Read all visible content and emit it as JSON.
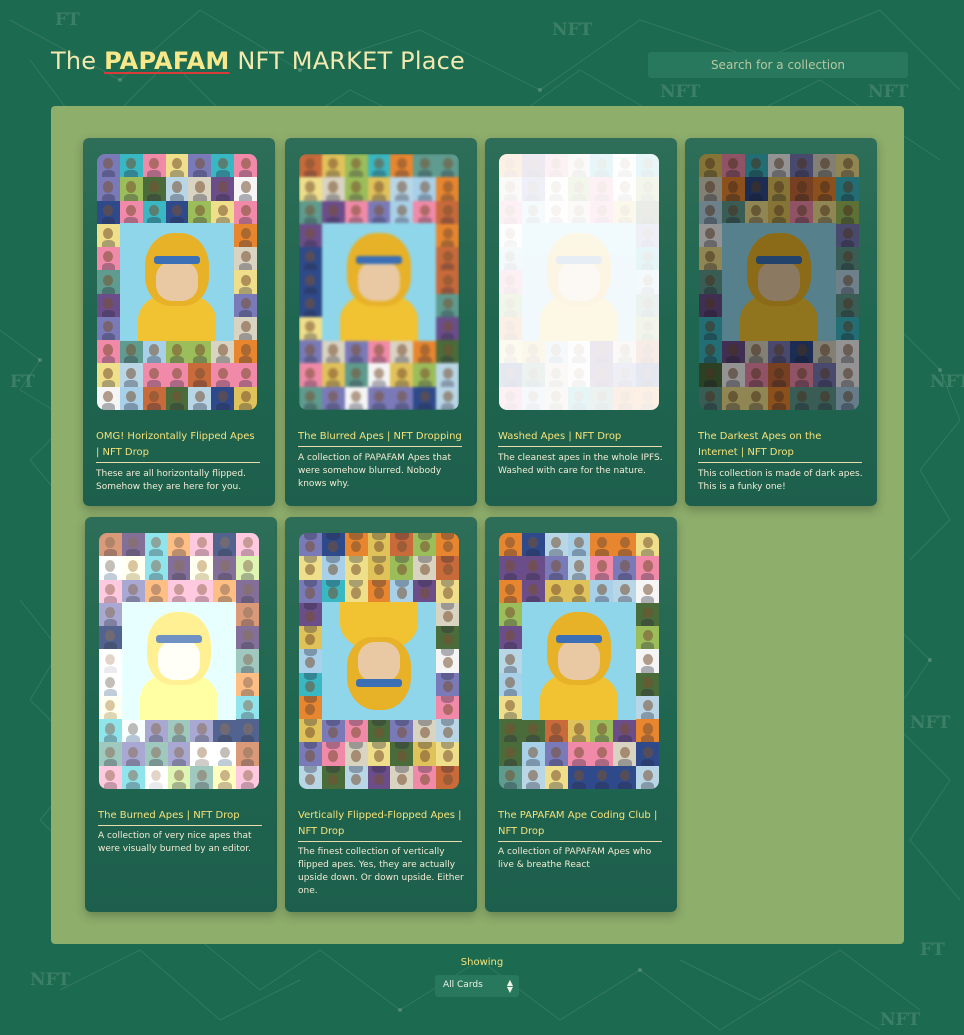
{
  "header": {
    "prefix": "The",
    "brand": "PAPAFAM",
    "suffix": "NFT MARKET Place"
  },
  "search": {
    "placeholder": "Search for a collection"
  },
  "cards": [
    {
      "title": "OMG! Horizontally Flipped Apes | NFT Drop",
      "description": "These are all horizontally flipped. Somehow they are here for you."
    },
    {
      "title": "The Blurred Apes | NFT Dropping",
      "description": "A collection of PAPAFAM Apes that were somehow blurred. Nobody knows why."
    },
    {
      "title": "Washed Apes | NFT Drop",
      "description": "The cleanest apes in the whole IPFS. Washed with care for the nature."
    },
    {
      "title": "The Darkest Apes on the Internet | NFT Drop",
      "description": "This collection is made of dark apes. This is a funky one!"
    },
    {
      "title": "The Burned Apes | NFT Drop",
      "description": "A collection of very nice apes that were visually burned by an editor."
    },
    {
      "title": "Vertically Flipped-Flopped Apes | NFT Drop",
      "description": "The finest collection of vertically flipped apes. Yes, they are actually upside down. Or down upside. Either one."
    },
    {
      "title": "The PAPAFAM Ape Coding Club | NFT Drop",
      "description": "A collection of PAPAFAM Apes who live & breathe React"
    }
  ],
  "footer": {
    "showing_label": "Showing",
    "filter_value": "All Cards"
  },
  "background_words": [
    "NFT",
    "FT",
    "N",
    "F",
    "T"
  ],
  "colors": {
    "background": "#1c6a4f",
    "panel": "#8eae6c",
    "accent_text": "#f4e27a",
    "brand_underline": "#d93b3b"
  }
}
